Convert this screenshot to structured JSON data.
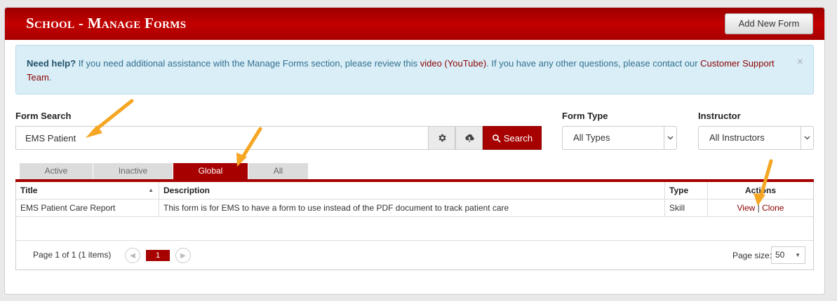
{
  "header": {
    "title": "School - Manage Forms",
    "add_button": "Add New Form"
  },
  "alert": {
    "need_help": "Need help?",
    "text_1": " If you need additional assistance with the Manage Forms section, please review this ",
    "video_link": "video (YouTube)",
    "text_2": ". If you have any other questions, please contact our ",
    "support_link": "Customer Support Team",
    "text_3": ".",
    "close": "×"
  },
  "search": {
    "label": "Form Search",
    "value": "EMS Patient",
    "button": "Search"
  },
  "form_type": {
    "label": "Form Type",
    "selected": "All Types"
  },
  "instructor": {
    "label": "Instructor",
    "selected": "All Instructors"
  },
  "tabs": [
    {
      "label": "Active"
    },
    {
      "label": "Inactive"
    },
    {
      "label": "Global"
    },
    {
      "label": "All"
    }
  ],
  "active_tab": "Global",
  "table": {
    "columns": {
      "title": "Title",
      "description": "Description",
      "type": "Type",
      "actions": "Actions"
    },
    "rows": [
      {
        "title": "EMS Patient Care Report",
        "description": "This form is for EMS to have a form to use instead of the PDF document to track patient care",
        "type": "Skill",
        "view": "View",
        "separator": "|",
        "clone": "Clone"
      }
    ]
  },
  "pager": {
    "info": "Page 1 of 1 (1 items)",
    "current_page": "1",
    "page_size_label": "Page size:",
    "page_size": "50"
  },
  "colors": {
    "brand": "#a60000",
    "annotation_arrow": "#f5a623",
    "alert_bg": "#d9eef7"
  },
  "icons": [
    "gear-icon",
    "cloud-download-icon",
    "search-icon",
    "chevron-down-icon",
    "chevron-left-icon",
    "chevron-right-icon",
    "close-icon",
    "sort-ascending-icon"
  ]
}
